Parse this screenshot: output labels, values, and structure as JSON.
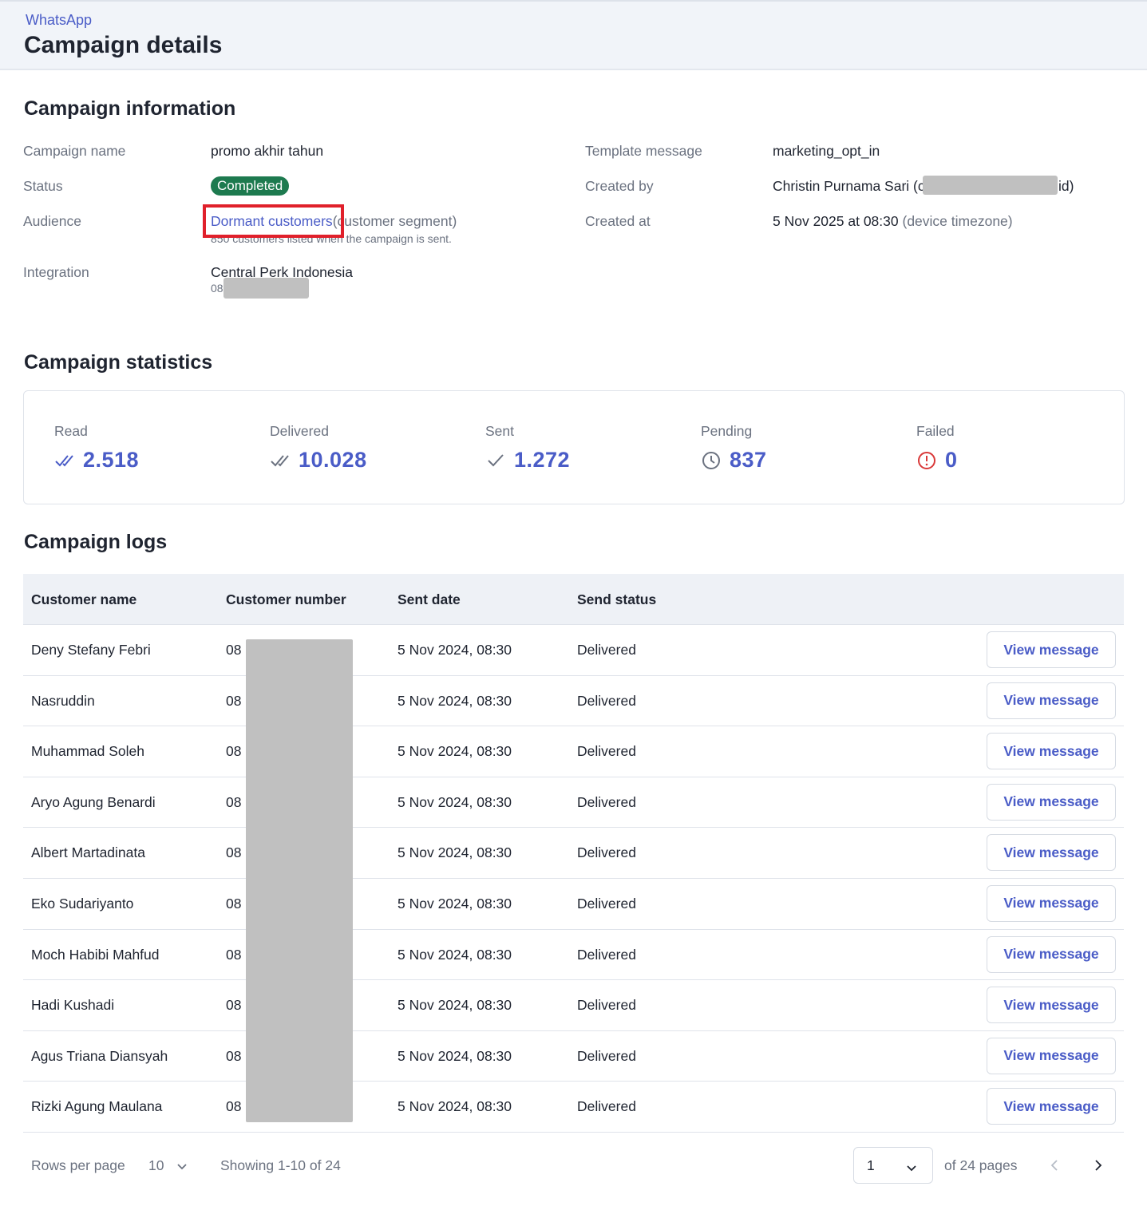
{
  "header": {
    "breadcrumb": "WhatsApp",
    "title": "Campaign details"
  },
  "info": {
    "title": "Campaign information",
    "campaign_name_label": "Campaign name",
    "campaign_name": "promo akhir tahun",
    "status_label": "Status",
    "status": "Completed",
    "audience_label": "Audience",
    "audience_link": "Dormant customers",
    "audience_suffix": "(customer segment)",
    "audience_note": "850 customers listed when the campaign is sent.",
    "integration_label": "Integration",
    "integration_name": "Central Perk Indonesia",
    "integration_number_prefix": "08",
    "template_label": "Template message",
    "template": "marketing_opt_in",
    "created_by_label": "Created by",
    "created_by_name": "Christin Purnama Sari (c",
    "created_by_suffix": "id)",
    "created_at_label": "Created at",
    "created_at": "5 Nov 2025 at 08:30",
    "created_at_tz": "(device timezone)"
  },
  "stats": {
    "title": "Campaign statistics",
    "items": [
      {
        "label": "Read",
        "value": "2.518",
        "icon": "double-check-icon"
      },
      {
        "label": "Delivered",
        "value": "10.028",
        "icon": "double-check-icon"
      },
      {
        "label": "Sent",
        "value": "1.272",
        "icon": "check-icon"
      },
      {
        "label": "Pending",
        "value": "837",
        "icon": "clock-icon"
      },
      {
        "label": "Failed",
        "value": "0",
        "icon": "alert-circle-icon"
      }
    ]
  },
  "logs": {
    "title": "Campaign logs",
    "columns": [
      "Customer name",
      "Customer number",
      "Sent date",
      "Send status"
    ],
    "action_label": "View message",
    "rows": [
      {
        "name": "Deny Stefany Febri",
        "number": "08",
        "date": "5 Nov 2024, 08:30",
        "status": "Delivered"
      },
      {
        "name": "Nasruddin",
        "number": "08",
        "date": "5 Nov 2024, 08:30",
        "status": "Delivered"
      },
      {
        "name": "Muhammad Soleh",
        "number": "08",
        "date": "5 Nov 2024, 08:30",
        "status": "Delivered"
      },
      {
        "name": "Aryo Agung Benardi",
        "number": "08",
        "date": "5 Nov 2024, 08:30",
        "status": "Delivered"
      },
      {
        "name": "Albert Martadinata",
        "number": "08",
        "date": "5 Nov 2024, 08:30",
        "status": "Delivered"
      },
      {
        "name": "Eko Sudariyanto",
        "number": "08",
        "date": "5 Nov 2024, 08:30",
        "status": "Delivered"
      },
      {
        "name": "Moch Habibi Mahfud",
        "number": "08",
        "date": "5 Nov 2024, 08:30",
        "status": "Delivered"
      },
      {
        "name": "Hadi Kushadi",
        "number": "08",
        "date": "5 Nov 2024, 08:30",
        "status": "Delivered"
      },
      {
        "name": "Agus Triana Diansyah",
        "number": "08",
        "date": "5 Nov 2024, 08:30",
        "status": "Delivered"
      },
      {
        "name": "Rizki Agung Maulana",
        "number": "08",
        "date": "5 Nov 2024, 08:30",
        "status": "Delivered"
      }
    ]
  },
  "pagination": {
    "rows_per_page_label": "Rows per page",
    "rows_per_page": "10",
    "showing": "Showing 1-10 of 24",
    "page": "1",
    "of_pages": "of 24 pages"
  },
  "colors": {
    "accent": "#4a5cc7",
    "status_green": "#1d7a4f",
    "failed_red": "#d93838",
    "highlight": "#e0202b"
  }
}
